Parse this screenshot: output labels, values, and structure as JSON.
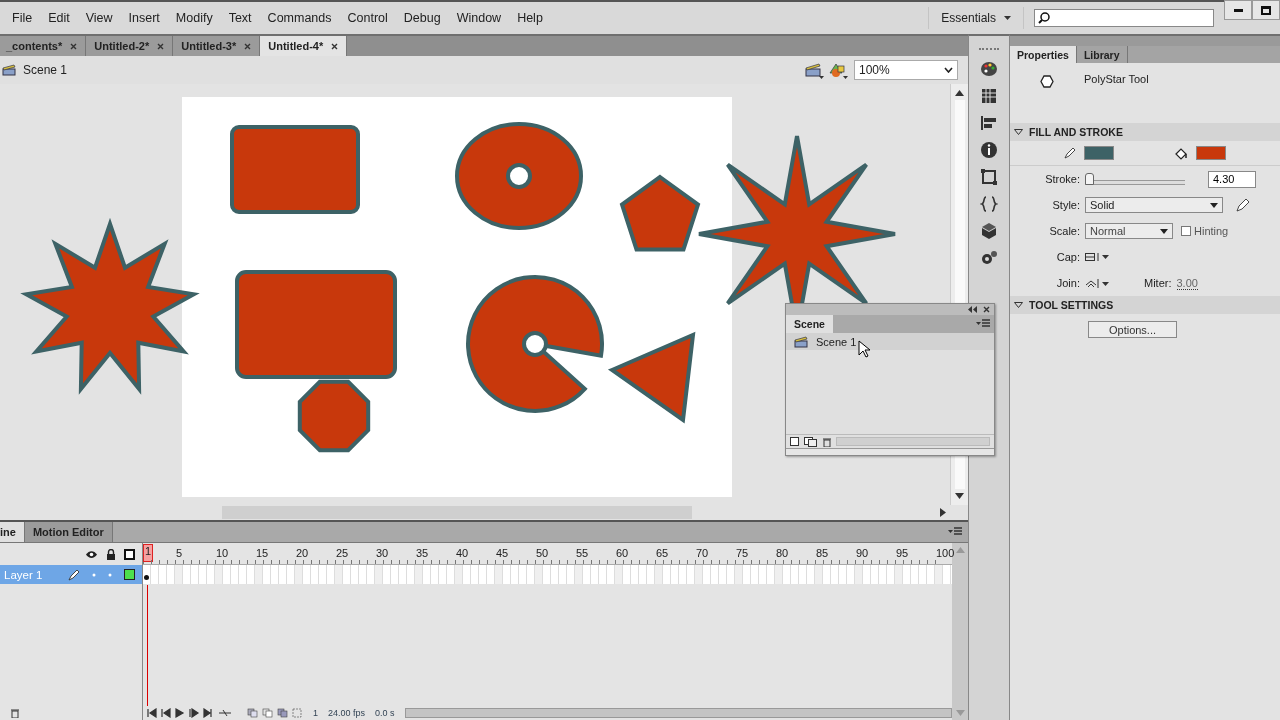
{
  "menu": [
    "File",
    "Edit",
    "View",
    "Insert",
    "Modify",
    "Text",
    "Commands",
    "Control",
    "Debug",
    "Window",
    "Help"
  ],
  "workspace": "Essentials",
  "document_tabs": [
    {
      "label": "_contents*",
      "selected": false
    },
    {
      "label": "Untitled-2*",
      "selected": false
    },
    {
      "label": "Untitled-3*",
      "selected": false
    },
    {
      "label": "Untitled-4*",
      "selected": true
    }
  ],
  "edit_bar": {
    "scene": "Scene 1",
    "zoom": "100%"
  },
  "properties": {
    "tabs": [
      {
        "label": "Properties",
        "selected": true
      },
      {
        "label": "Library",
        "selected": false
      }
    ],
    "tool": "PolyStar Tool",
    "fill_and_stroke": {
      "title": "FILL AND STROKE",
      "swatches": [
        {
          "kind": "stroke",
          "color": "#3d6266"
        },
        {
          "kind": "fill",
          "color": "#c8380c"
        }
      ],
      "stroke_label": "Stroke:",
      "stroke": {
        "level": 0.0,
        "value": "4.30"
      },
      "style_label": "Style:",
      "style": "Solid",
      "scale_label": "Scale:",
      "scale": "Normal",
      "hinting": {
        "label": "Hinting",
        "checked": false
      },
      "cap_label": "Cap:",
      "join_label": "Join:",
      "miter_label": "Miter:",
      "miter": "3.00"
    },
    "tool_settings": {
      "title": "TOOL SETTINGS",
      "button": "Options..."
    }
  },
  "scene_panel": {
    "title": "Scene",
    "scenes": [
      {
        "label": "Scene 1",
        "selected": true
      }
    ]
  },
  "timeline": {
    "tabs": [
      {
        "label": "ine",
        "selected": true
      },
      {
        "label": "Motion Editor",
        "selected": false
      }
    ],
    "frame_numbers": [
      "1",
      "5",
      "10",
      "15",
      "20",
      "25",
      "30",
      "35",
      "40",
      "45",
      "50",
      "55",
      "60",
      "65",
      "70",
      "75",
      "80",
      "85",
      "90",
      "95",
      "100"
    ],
    "layers": [
      {
        "name": "Layer 1",
        "selected": true
      }
    ],
    "current_frame": "1",
    "frame_rate": "24.00 fps",
    "elapsed": "0.0 s"
  }
}
